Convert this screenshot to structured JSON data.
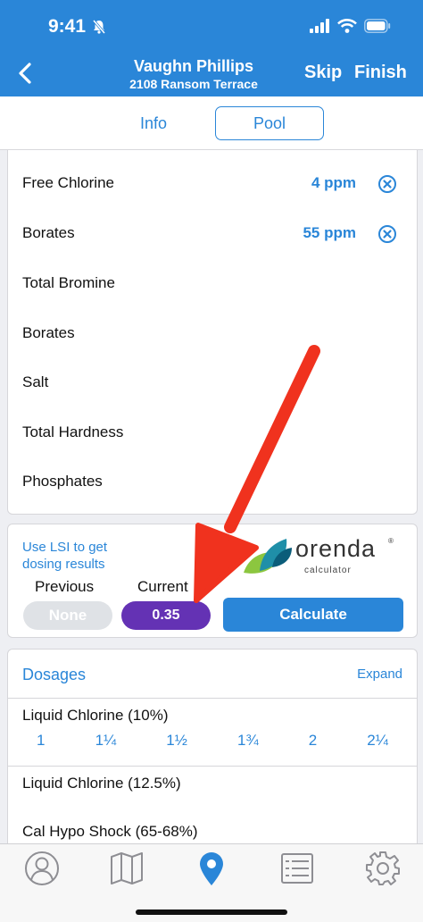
{
  "status_bar": {
    "time": "9:41"
  },
  "nav": {
    "title": "Vaughn Phillips",
    "subtitle": "2108 Ransom Terrace",
    "skip_label": "Skip",
    "finish_label": "Finish"
  },
  "tabs": [
    {
      "label": "Info",
      "selected": false
    },
    {
      "label": "Pool",
      "selected": true
    }
  ],
  "readings": [
    {
      "name": "Free Chlorine",
      "value": "4  ppm",
      "clearable": true
    },
    {
      "name": "Borates",
      "value": "55  ppm",
      "clearable": true
    },
    {
      "name": "Total Bromine",
      "value": "",
      "clearable": false
    },
    {
      "name": "Borates",
      "value": "",
      "clearable": false
    },
    {
      "name": "Salt",
      "value": "",
      "clearable": false
    },
    {
      "name": "Total Hardness",
      "value": "",
      "clearable": false
    },
    {
      "name": "Phosphates",
      "value": "",
      "clearable": false
    }
  ],
  "lsi": {
    "link_text": "Use LSI to get dosing results",
    "logo_word": "orenda",
    "logo_sub": "calculator",
    "logo_reg": "®",
    "previous_label": "Previous",
    "current_label": "Current",
    "previous_value": "None",
    "current_value": "0.35",
    "calculate_label": "Calculate"
  },
  "dosages": {
    "title": "Dosages",
    "expand_label": "Expand",
    "items": [
      {
        "name": "Liquid Chlorine (10%)",
        "amounts": [
          "1",
          "1¼",
          "1½",
          "1¾",
          "2",
          "2¼"
        ]
      },
      {
        "name": "Liquid Chlorine (12.5%)"
      },
      {
        "name": "Cal Hypo Shock (65-68%)"
      }
    ]
  },
  "colors": {
    "brand_blue": "#2a86d8",
    "current_purple": "#6432b4",
    "annotation_red": "#f0321e"
  },
  "tab_bar": {
    "icons": [
      "user-icon",
      "map-icon",
      "location-pin-icon",
      "list-icon",
      "gear-icon"
    ],
    "active": "location-pin-icon"
  }
}
